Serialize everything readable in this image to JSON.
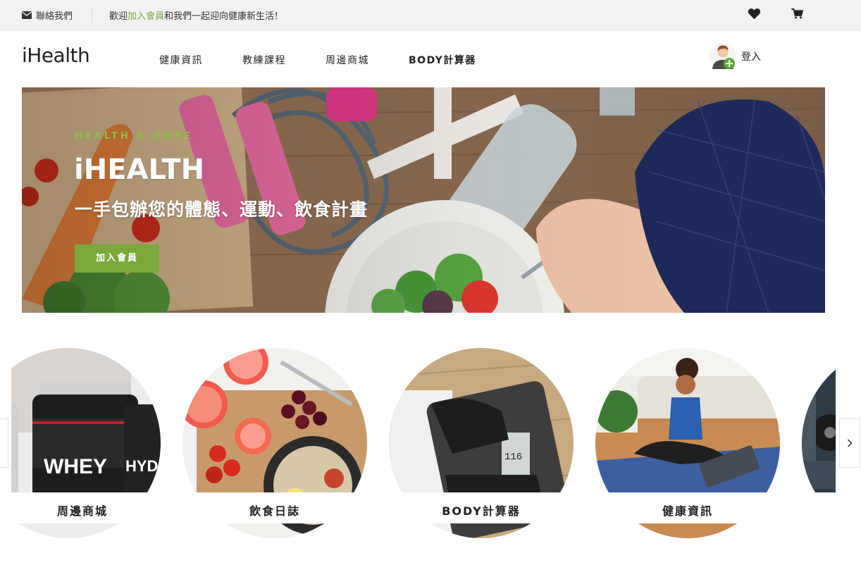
{
  "topbar": {
    "contact_label": "聯絡我們",
    "welcome_prefix": "歡迎",
    "welcome_link": "加入會員",
    "welcome_suffix": "和我們一起迎向健康新生活！"
  },
  "header": {
    "logo": "iHealth",
    "nav": [
      "健康資訊",
      "教練課程",
      "周邊商城",
      "BODY計算器"
    ],
    "login_label": "登入"
  },
  "hero": {
    "tag": "HEALTH & HOPE",
    "title": "iHEALTH",
    "subtitle": "一手包辦您的體態、運動、飲食計畫",
    "button": "加入會員"
  },
  "carousel": {
    "cards": [
      {
        "label": "周邊商城"
      },
      {
        "label": "飲食日誌"
      },
      {
        "label": "BODY計算器"
      },
      {
        "label": "健康資訊"
      }
    ]
  },
  "colors": {
    "accent": "#7aa83a",
    "topbar_bg": "#f2f2f2"
  },
  "icons": [
    "envelope-icon",
    "heart-icon",
    "cart-icon",
    "user-add-icon",
    "chevron-right-icon",
    "chevron-left-icon"
  ]
}
